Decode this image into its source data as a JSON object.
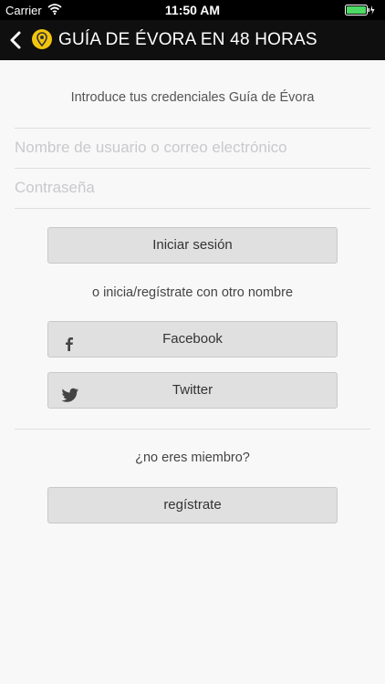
{
  "status_bar": {
    "carrier": "Carrier",
    "time": "11:50 AM"
  },
  "nav": {
    "title": "GUÍA DE ÉVORA EN 48 HORAS",
    "back_icon": "chevron-left-icon",
    "logo_icon": "map-pin-icon",
    "logo_color": "#f1c40f"
  },
  "login": {
    "intro": "Introduce tus credenciales Guía de Évora",
    "username_placeholder": "Nombre de usuario o correo electrónico",
    "password_placeholder": "Contraseña",
    "login_button": "Iniciar sesión"
  },
  "social": {
    "prompt": "o inicia/regístrate con otro nombre",
    "facebook_button": "Facebook",
    "twitter_button": "Twitter"
  },
  "register": {
    "prompt": "¿no eres miembro?",
    "register_button": "regístrate"
  }
}
